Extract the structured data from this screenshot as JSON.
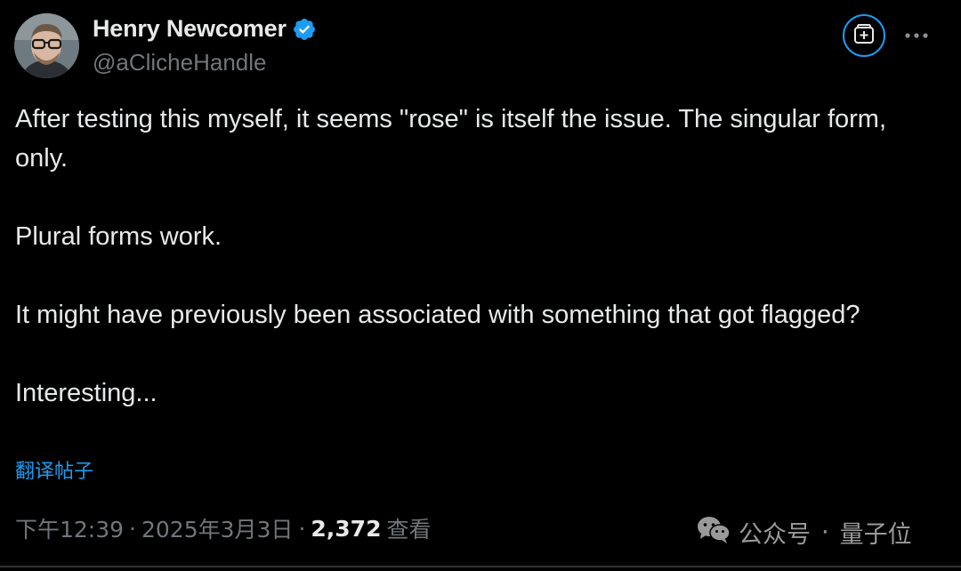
{
  "author": {
    "display_name": "Henry Newcomer",
    "handle": "@aClicheHandle",
    "verified": true
  },
  "tweet": {
    "paragraphs": [
      "After testing this myself, it seems \"rose\" is itself the issue. The singular form, only.",
      "Plural forms work.",
      "It might have previously been associated with something that got flagged?",
      "Interesting..."
    ],
    "translate_label": "翻译帖子"
  },
  "meta": {
    "time": "下午12:39",
    "separator": "·",
    "date": "2025年3月3日",
    "views_count": "2,372",
    "views_label": "查看"
  },
  "watermark": {
    "icon": "wechat-icon",
    "account_type": "公众号",
    "separator": "·",
    "account_name": "量子位"
  },
  "icons": {
    "verified": "verified-badge-icon",
    "grok": "grok-icon",
    "more": "more-horizontal-icon"
  },
  "colors": {
    "background": "#000000",
    "text": "#e7e9ea",
    "secondary_text": "#71767b",
    "accent": "#1d9bf0"
  }
}
